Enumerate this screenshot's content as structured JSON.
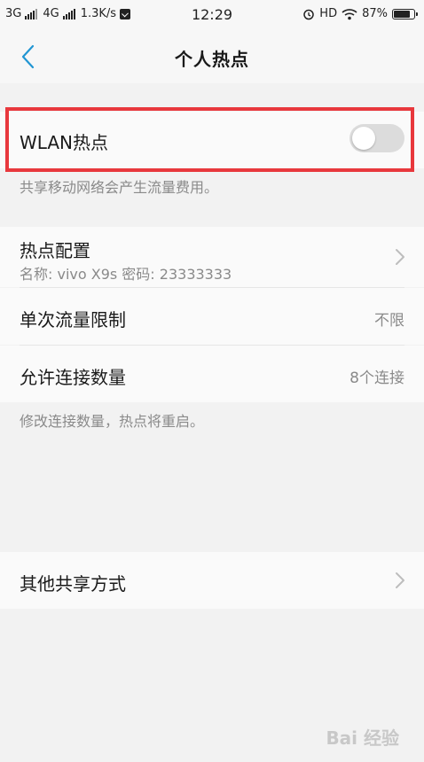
{
  "statusbar": {
    "net1": "3G",
    "net2": "4G",
    "speed": "1.3K/s",
    "time": "12:29",
    "hd": "HD",
    "battery": "87%",
    "battery_level": 0.87,
    "icons": [
      "signal-icon",
      "message-icon",
      "alarm-icon",
      "wifi-icon",
      "battery-icon"
    ]
  },
  "header": {
    "title": "个人热点",
    "back_icon": "chevron-left-icon"
  },
  "wlan": {
    "label": "WLAN热点",
    "enabled": false,
    "note": "共享移动网络会产生流量费用。"
  },
  "settings": {
    "config_label": "热点配置",
    "config_sub": "名称: vivo X9s  密码: 23333333",
    "limit_label": "单次流量限制",
    "limit_value": "不限",
    "connections_label": "允许连接数量",
    "connections_value": "8个连接",
    "note": "修改连接数量，热点将重启。"
  },
  "other": {
    "label": "其他共享方式"
  },
  "watermark": "Bai 经验",
  "colors": {
    "accent": "#2196d3",
    "highlight": "#e8383d",
    "toggle_off": "#dcdcdc"
  }
}
